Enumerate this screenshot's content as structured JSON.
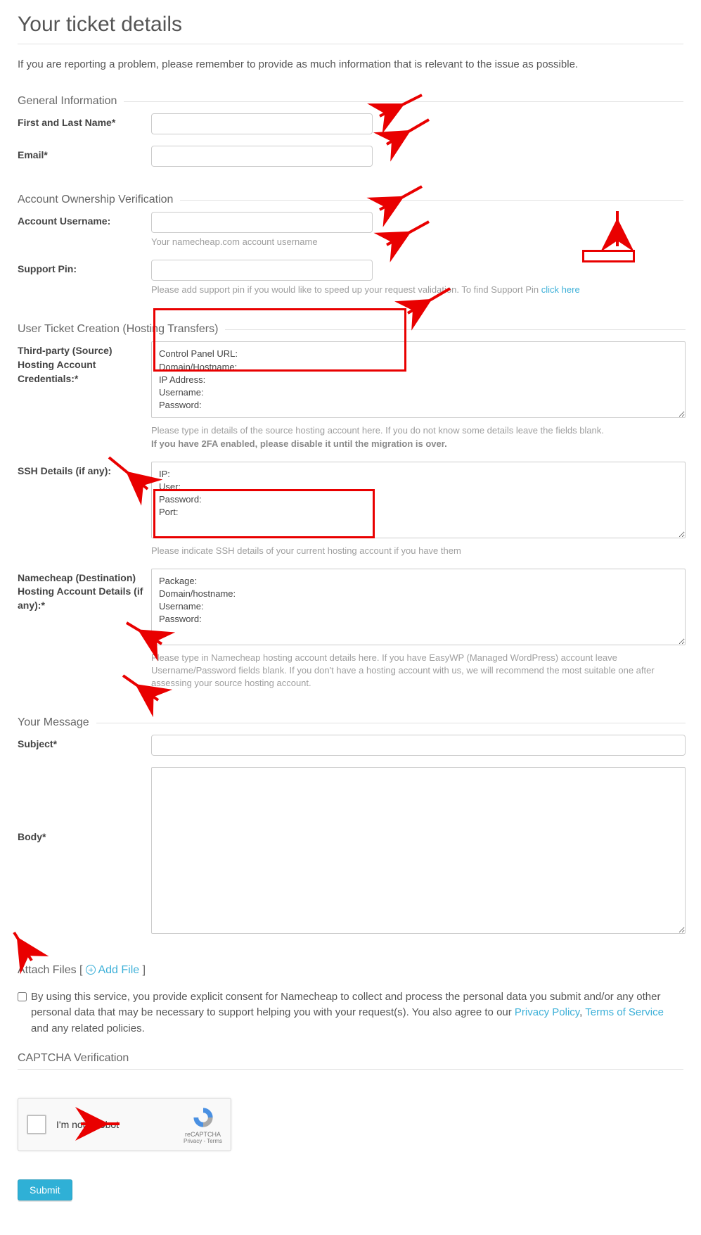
{
  "page": {
    "title": "Your ticket details",
    "intro": "If you are reporting a problem, please remember to provide as much information that is relevant to the issue as possible."
  },
  "sections": {
    "general": {
      "legend": "General Information",
      "name_label": "First and Last Name",
      "email_label": "Email"
    },
    "verification": {
      "legend": "Account Ownership Verification",
      "username_label": "Account Username:",
      "username_hint": "Your namecheap.com account username",
      "pin_label": "Support Pin:",
      "pin_hint_prefix": "Please add support pin if you would like to speed up your request validation. To find Support Pin ",
      "pin_hint_link": "click here"
    },
    "hosting": {
      "legend": "User Ticket Creation (Hosting Transfers)",
      "source_label": "Third-party (Source) Hosting Account Credentials:*",
      "source_value": "Control Panel URL:\nDomain/Hostname:\nIP Address:\nUsername:\nPassword:",
      "source_hint": "Please type in details of the source hosting account here. If you do not know some details leave the fields blank.",
      "source_hint_bold": "If you have 2FA enabled, please disable it until the migration is over.",
      "ssh_label": "SSH Details (if any):",
      "ssh_value": "IP:\nUser:\nPassword:\nPort:",
      "ssh_hint": "Please indicate SSH details of your current hosting account if you have them",
      "dest_label": "Namecheap (Destination) Hosting Account Details (if any):*",
      "dest_value": "Package:\nDomain/hostname:\nUsername:\nPassword:",
      "dest_hint": "Please type in Namecheap hosting account details here. If you have EasyWP (Managed WordPress) account leave Username/Password fields blank. If you don't have a hosting account with us, we will recommend the most suitable one after assessing your source hosting account."
    },
    "message": {
      "legend": "Your Message",
      "subject_label": "Subject",
      "body_label": "Body"
    },
    "attach": {
      "label_prefix": "Attach Files [ ",
      "add_link": "Add File",
      "label_suffix": " ]"
    },
    "consent": {
      "text_1": "By using this service, you provide explicit consent for Namecheap to collect and process the personal data you submit and/or any other personal data that may be necessary to support helping you with your request(s). You also agree to our ",
      "privacy": "Privacy Policy",
      "sep": ", ",
      "terms": "Terms of Service",
      "text_2": " and any related policies."
    },
    "captcha": {
      "legend": "CAPTCHA Verification",
      "robot_label": "I'm not a robot",
      "brand": "reCAPTCHA",
      "small": "Privacy - Terms"
    }
  },
  "buttons": {
    "submit": "Submit"
  }
}
